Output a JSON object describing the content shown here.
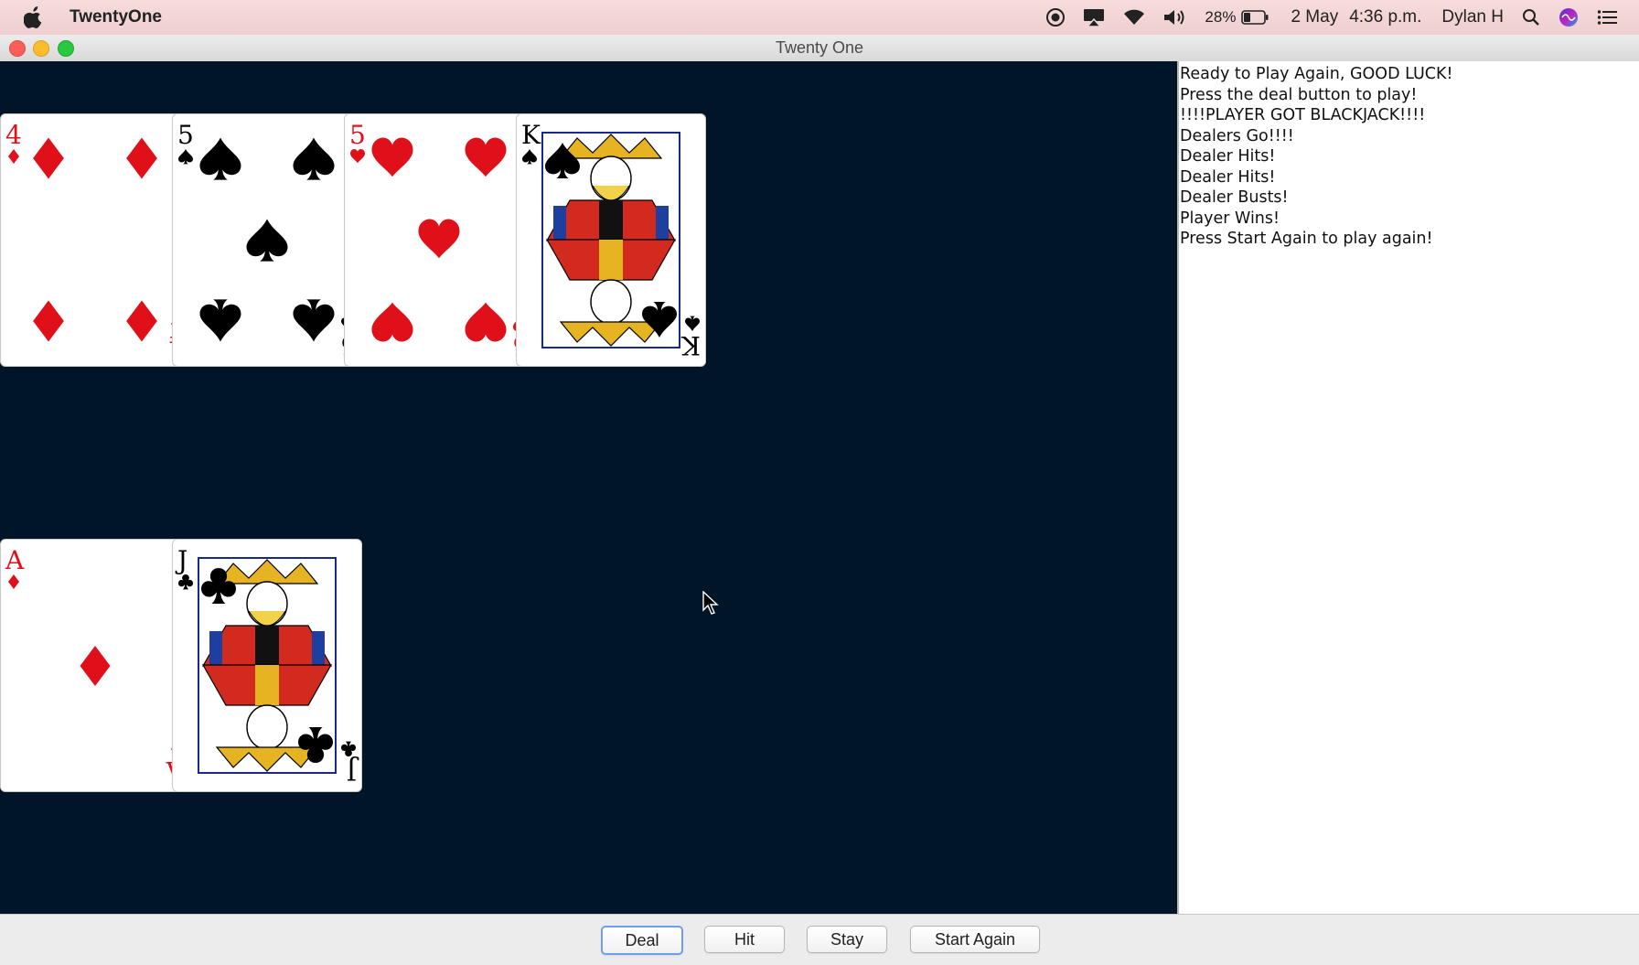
{
  "menubar": {
    "app_name": "TwentyOne",
    "battery": "28%",
    "date": "2 May",
    "time": "4:36 p.m.",
    "user": "Dylan H"
  },
  "window": {
    "title": "Twenty One"
  },
  "dealer_hand": [
    {
      "rank": "4",
      "suit": "diamonds"
    },
    {
      "rank": "5",
      "suit": "spades"
    },
    {
      "rank": "5",
      "suit": "hearts"
    },
    {
      "rank": "K",
      "suit": "spades"
    }
  ],
  "player_hand": [
    {
      "rank": "A",
      "suit": "diamonds"
    },
    {
      "rank": "J",
      "suit": "clubs"
    }
  ],
  "log": [
    "Ready to Play Again, GOOD LUCK!",
    "Press the deal button to play!",
    "!!!!PLAYER GOT BLACKJACK!!!!",
    "Dealers Go!!!!",
    "Dealer Hits!",
    "Dealer Hits!",
    "Dealer Busts!",
    "Player Wins!",
    "Press Start Again to play again!"
  ],
  "buttons": {
    "deal": "Deal",
    "hit": "Hit",
    "stay": "Stay",
    "start_again": "Start Again"
  },
  "colors": {
    "table": "#001528",
    "red_suit": "#e0101a",
    "black_suit": "#000000"
  }
}
